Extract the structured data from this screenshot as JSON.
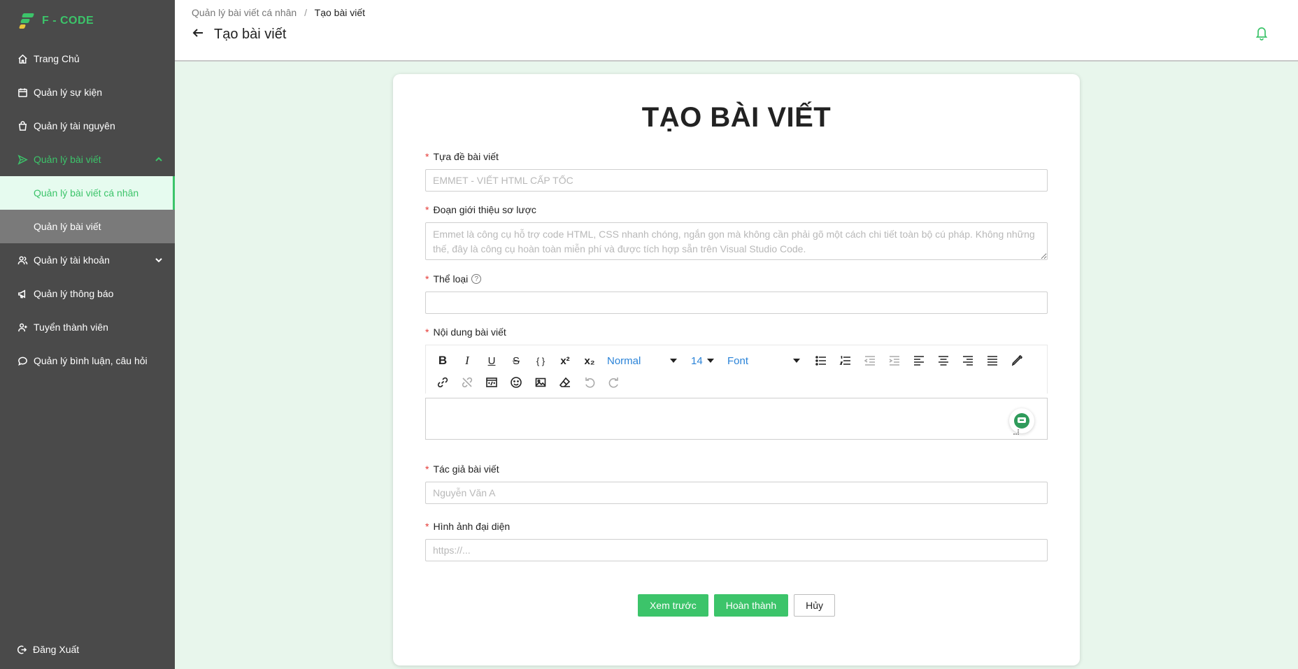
{
  "brand": {
    "name": "F - CODE"
  },
  "sidebar": {
    "items": [
      {
        "label": "Trang Chủ",
        "icon": "home-icon"
      },
      {
        "label": "Quản lý sự kiện",
        "icon": "calendar-icon"
      },
      {
        "label": "Quản lý tài nguyên",
        "icon": "box-icon"
      },
      {
        "label": "Quản lý bài viết",
        "icon": "send-icon",
        "expanded": true
      },
      {
        "label": "Quản lý tài khoản",
        "icon": "users-icon"
      },
      {
        "label": "Quản lý thông báo",
        "icon": "megaphone-icon"
      },
      {
        "label": "Tuyển thành viên",
        "icon": "user-add-icon"
      },
      {
        "label": "Quản lý bình luận, câu hỏi",
        "icon": "comment-icon"
      }
    ],
    "subitems": [
      {
        "label": "Quản lý bài viết cá nhân",
        "selected": true
      },
      {
        "label": "Quản lý bài viết",
        "selected": false
      }
    ],
    "logout": "Đăng Xuất"
  },
  "header": {
    "breadcrumb": [
      "Quản lý bài viết cá nhân",
      "Tạo bài viết"
    ],
    "separator": "/",
    "title": "Tạo bài viết"
  },
  "form": {
    "heading": "TẠO BÀI VIẾT",
    "title_label": "Tựa đề bài viết",
    "title_placeholder": "EMMET - VIẾT HTML CẤP TỐC",
    "intro_label": "Đoạn giới thiệu sơ lược",
    "intro_placeholder": "Emmet là công cụ hỗ trợ code HTML, CSS nhanh chóng, ngắn gọn mà không cần phải gõ một cách chi tiết toàn bộ cú pháp. Không những thế, đây là công cụ hoàn toàn miễn phí và được tích hợp sẵn trên Visual Studio Code.",
    "category_label": "Thể loại",
    "category_help": "?",
    "content_label": "Nội dung bài viết",
    "author_label": "Tác giả bài viết",
    "author_placeholder": "Nguyễn Văn A",
    "image_label": "Hình ảnh đại diện",
    "image_placeholder": "https://...",
    "required_mark": "*"
  },
  "editor": {
    "bold": "B",
    "italic": "I",
    "underline": "U",
    "strike": "S",
    "code": "{ }",
    "superscript": "x²",
    "subscript": "x₂",
    "heading_select": "Normal",
    "size_select": "14",
    "font_select": "Font"
  },
  "actions": {
    "preview": "Xem trước",
    "submit": "Hoàn thành",
    "cancel": "Hủy"
  },
  "colors": {
    "accent": "#3cc46a",
    "sidebar_bg": "#4a4a4a",
    "page_bg": "#e8f6ec",
    "required": "#e53935",
    "editor_select": "#2a83d8"
  }
}
